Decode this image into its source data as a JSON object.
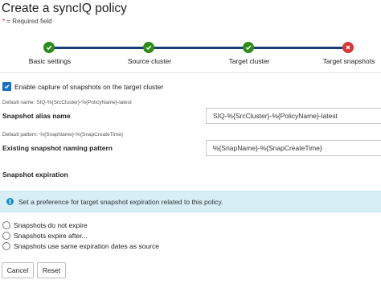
{
  "page": {
    "title": "Create a syncIQ policy",
    "required_star": "*",
    "required_text": "= Required field"
  },
  "wizard": {
    "steps": [
      {
        "label": "Basic settings",
        "status": "complete"
      },
      {
        "label": "Source cluster",
        "status": "complete"
      },
      {
        "label": "Target cluster",
        "status": "complete"
      },
      {
        "label": "Target snapshots",
        "status": "error"
      }
    ]
  },
  "form": {
    "enable_capture_label": "Enable capture of snapshots on the target cluster",
    "enable_capture_checked": true,
    "alias_hint": "Default name: SIQ-%{SrcCluster}-%{PolicyName}-latest",
    "alias_label": "Snapshot alias name",
    "alias_value": "SIQ-%{SrcCluster}-%{PolicyName}-latest",
    "pattern_hint": "Default pattern: %{SnapName}-%{SnapCreateTime}",
    "pattern_label": "Existing snapshot naming pattern",
    "pattern_value": "%{SnapName}-%{SnapCreateTime}"
  },
  "expiration": {
    "heading": "Snapshot expiration",
    "info_icon": "info-icon",
    "info_text": "Set a preference for target snapshot expiration related to this policy.",
    "options": [
      "Snapshots do not expire",
      "Snapshots expire after...",
      "Snapshots use same expiration dates as source"
    ]
  },
  "buttons": {
    "cancel": "Cancel",
    "reset": "Reset"
  }
}
